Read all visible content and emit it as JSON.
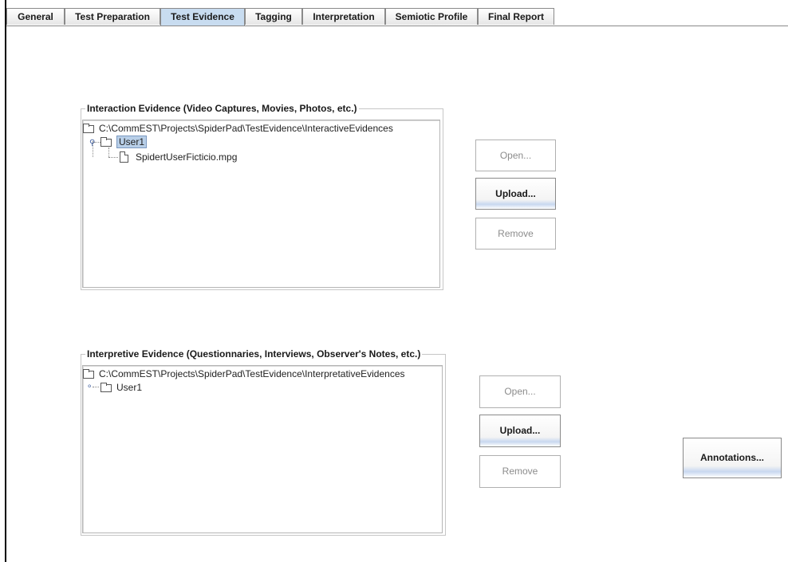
{
  "tabs": [
    {
      "label": "General",
      "active": false
    },
    {
      "label": "Test Preparation",
      "active": false
    },
    {
      "label": "Test Evidence",
      "active": true
    },
    {
      "label": "Tagging",
      "active": false
    },
    {
      "label": "Interpretation",
      "active": false
    },
    {
      "label": "Semiotic Profile",
      "active": false
    },
    {
      "label": "Final Report",
      "active": false
    }
  ],
  "interaction_panel": {
    "title": "Interaction Evidence (Video Captures, Movies, Photos, etc.)",
    "root_path": "C:\\CommEST\\Projects\\SpiderPad\\TestEvidence\\InteractiveEvidences",
    "user_node": "User1",
    "file_node": "SpidertUserFicticio.mpg",
    "buttons": {
      "open": "Open...",
      "upload": "Upload...",
      "remove": "Remove"
    }
  },
  "interpretive_panel": {
    "title": "Interpretive Evidence (Questionnaries, Interviews, Observer's Notes, etc.)",
    "root_path": "C:\\CommEST\\Projects\\SpiderPad\\TestEvidence\\InterpretativeEvidences",
    "user_node": "User1",
    "buttons": {
      "open": "Open...",
      "upload": "Upload...",
      "remove": "Remove"
    }
  },
  "annotations_button": "Annotations...",
  "colors": {
    "active_tab": "#c8dcf0",
    "selection": "#b8cfe8"
  }
}
